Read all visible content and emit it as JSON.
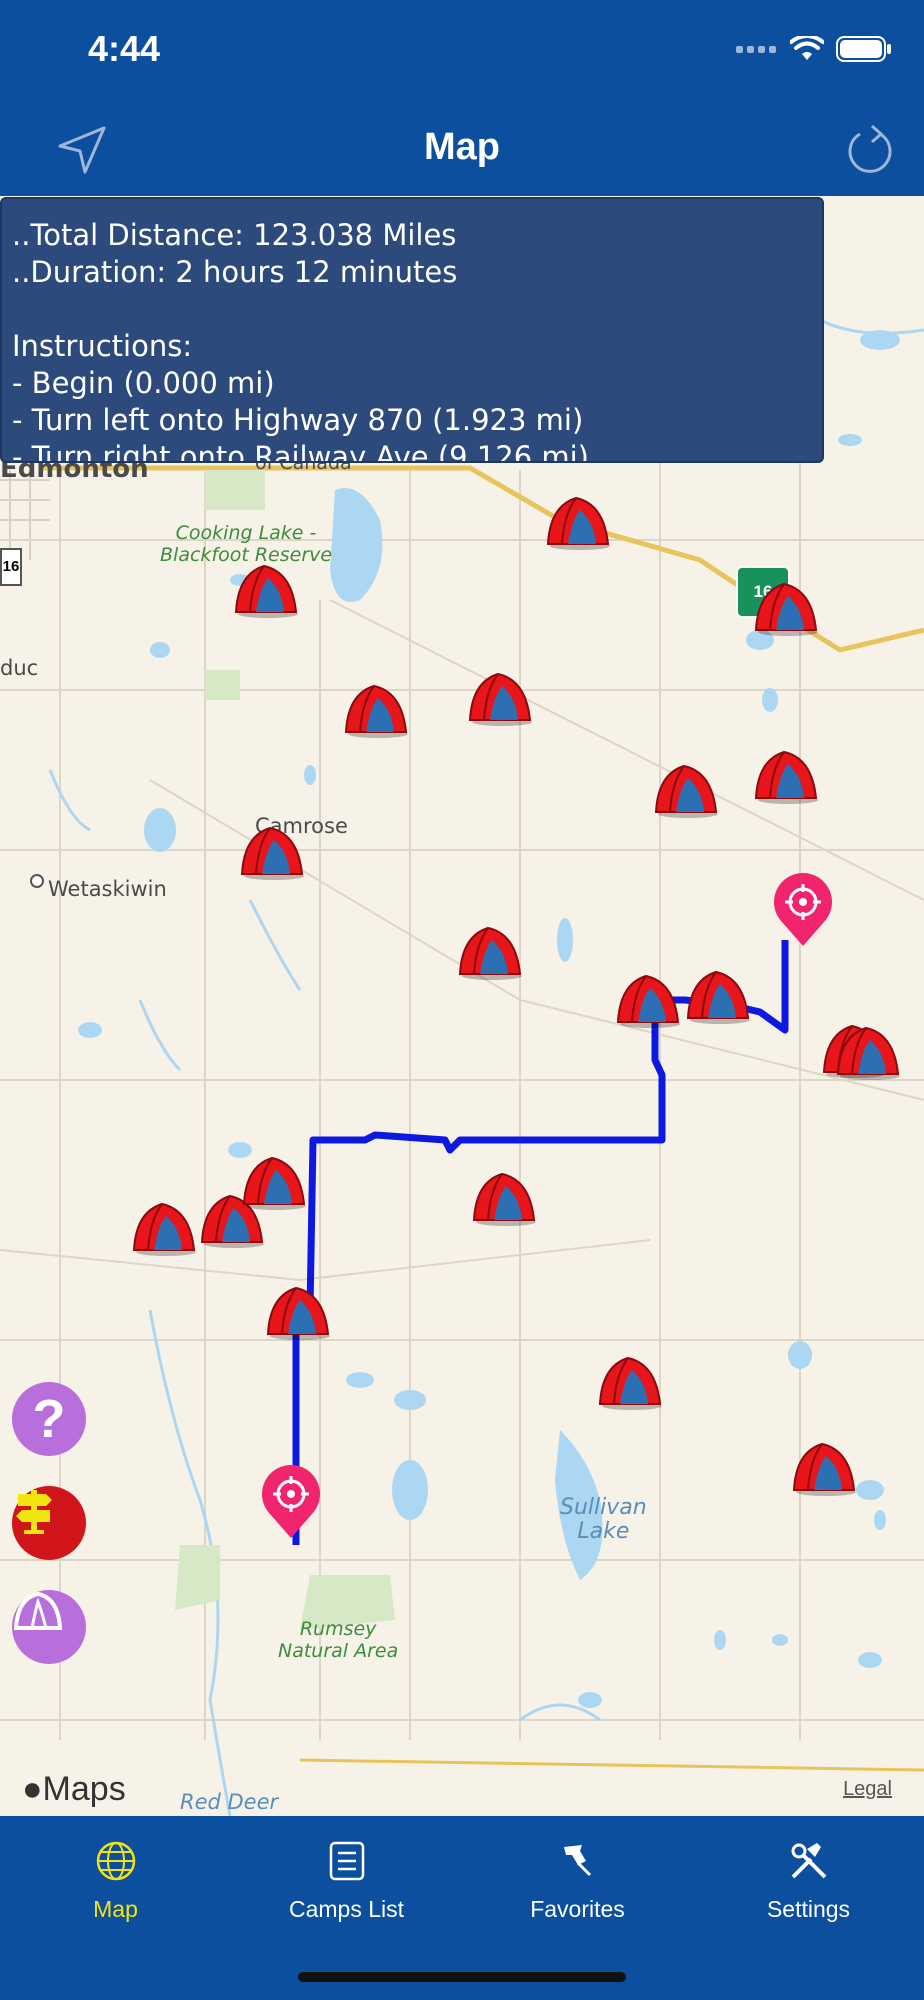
{
  "status_bar": {
    "time": "4:44"
  },
  "nav": {
    "title": "Map",
    "left_icon": "location-arrow-icon",
    "right_icon": "refresh-icon"
  },
  "route_info": {
    "line1": "..Total Distance: 123.038 Miles",
    "line2": "..Duration: 2 hours 12 minutes",
    "line3": "Instructions:",
    "line4": "- Begin (0.000 mi)",
    "line5": "- Turn left onto Highway 870 (1.923 mi)",
    "line6": "- Turn right onto Railway Ave (9.126 mi)"
  },
  "map_labels": {
    "edmonton": "Edmonton",
    "of_canada": "of Canada",
    "cooking_lake": "Cooking Lake -\nBlackfoot Reserve",
    "duc": "duc",
    "camrose": "Camrose",
    "wetaskiwin": "Wetaskiwin",
    "sullivan_lake": "Sullivan\nLake",
    "rumsey": "Rumsey\nNatural Area",
    "red_deer": "Red Deer",
    "highway_16": "16",
    "highway_shield_left": "16",
    "maps_brand": "Maps",
    "legal": "Legal"
  },
  "side_buttons": [
    "help-icon",
    "signpost-icon",
    "tent-icon"
  ],
  "tabs": [
    {
      "label": "Map",
      "icon": "globe-icon",
      "active": true
    },
    {
      "label": "Camps List",
      "icon": "list-icon",
      "active": false
    },
    {
      "label": "Favorites",
      "icon": "pin-icon",
      "active": false
    },
    {
      "label": "Settings",
      "icon": "tools-icon",
      "active": false
    }
  ],
  "colors": {
    "brand": "#0b4f9e",
    "route": "#0d18e0",
    "camp": "#e8151b",
    "pin": "#f0256e",
    "active_tab": "#f2e40f"
  }
}
